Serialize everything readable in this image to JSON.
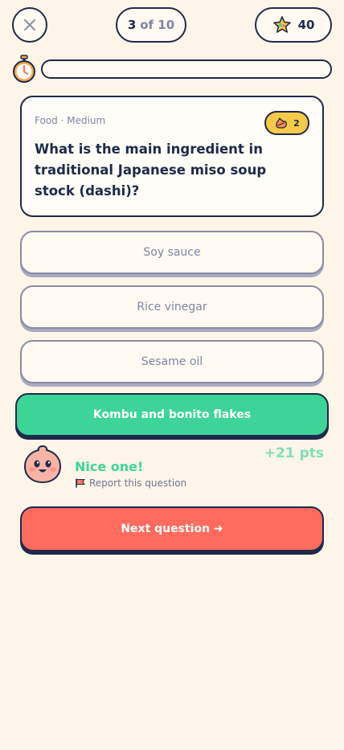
{
  "header": {
    "progress_current": "3",
    "progress_of": "of 10",
    "score": "40"
  },
  "timer": {
    "remaining_fraction": 0
  },
  "question": {
    "meta": "Food · Medium",
    "streak": "2",
    "text": "What is the main ingredient in traditional Japanese miso soup stock (dashi)?"
  },
  "answers": [
    {
      "label": "Soy sauce",
      "state": "neutral"
    },
    {
      "label": "Rice vinegar",
      "state": "neutral"
    },
    {
      "label": "Sesame oil",
      "state": "neutral"
    },
    {
      "label": "Kombu and bonito flakes",
      "state": "correct"
    }
  ],
  "feedback": {
    "title": "Nice one!",
    "report_label": "Report this question",
    "points": "+21 pts"
  },
  "next_button": {
    "label": "Next question ➜"
  },
  "icons": {
    "close": "close-icon",
    "score": "star-icon",
    "timer": "stopwatch-icon",
    "streak": "flame-icon",
    "report": "flag-icon",
    "mascot": "smiley-mascot"
  },
  "colors": {
    "background": "#fdf5e8",
    "ink": "#1e2a4a",
    "correct": "#3dd597",
    "next": "#ff6b5e",
    "badge": "#f7c948"
  }
}
